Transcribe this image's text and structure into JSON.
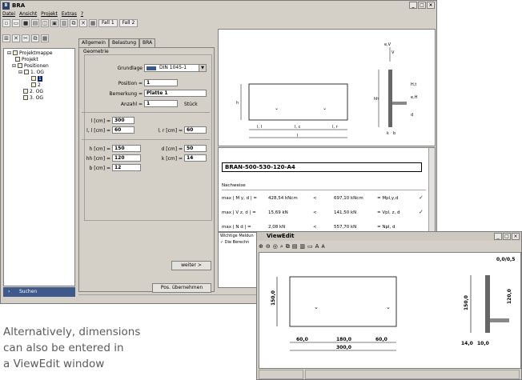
{
  "app": {
    "title": "BRA",
    "window_buttons": [
      "_",
      "□",
      "×"
    ]
  },
  "menu": [
    "Datei",
    "Ansicht",
    "Projekt",
    "Extras",
    "?"
  ],
  "toolbar": {
    "fall1": "Fall 1",
    "fall2": "Fall 2"
  },
  "tree": {
    "items": [
      "Projektmappe",
      "Projekt",
      "Positionen",
      "1. OG",
      "1",
      "2",
      "2. OG",
      "3. OG"
    ],
    "search": "Suchen"
  },
  "tabs": [
    "Allgemein",
    "Belastung",
    "BRA"
  ],
  "form": {
    "group_title": "Geometrie",
    "grundlage_label": "Grundlage",
    "grundlage_value": "DIN 1045-1",
    "position_label": "Position =",
    "position_value": "1",
    "bemerkung_label": "Bemerkung =",
    "bemerkung_value": "Platte 1",
    "anzahl_label": "Anzahl =",
    "anzahl_value": "1",
    "anzahl_unit": "Stück",
    "l_label": "l [cm] =",
    "l_value": "300",
    "ll_label": "l, l [cm] =",
    "ll_value": "60",
    "lr_label": "l, r [cm] =",
    "lr_value": "60",
    "h_label": "h [cm] =",
    "h_value": "150",
    "d_label": "d [cm] =",
    "d_value": "50",
    "hh_label": "hh [cm] =",
    "hh_value": "120",
    "k_label": "k [cm] =",
    "k_value": "14",
    "b_label": "b [cm] =",
    "b_value": "12",
    "weiter": "weiter >",
    "uebernehmen": "Pos. übernehmen"
  },
  "drawing": {
    "ll": "l, l",
    "lc": "l, c",
    "lr": "l, r",
    "l": "l",
    "h": "h",
    "ev": "e,V",
    "hh": "hh",
    "d": "d",
    "k": "k",
    "b": "b",
    "eh": "e,H",
    "ht": "H,t",
    "v": "V"
  },
  "results": {
    "code": "BRAN-500-530-120-A4",
    "heading": "Nachweise",
    "rows": [
      {
        "label": "max | M y, d | =",
        "value": "428,54 kNcm",
        "op": "<",
        "limit": "697,10 kNcm",
        "ref": "= Mpl,y,d"
      },
      {
        "label": "max | V z, d | =",
        "value": "15,69 kN",
        "op": "<",
        "limit": "141,50 kN",
        "ref": "= Vpl, z, d"
      },
      {
        "label": "max | N d | =",
        "value": "2,08 kN",
        "op": "<",
        "limit": "557,70 kN",
        "ref": "= Npl, d"
      }
    ],
    "messages_header": "Wichtige Meldun",
    "message": "Die Berechn"
  },
  "viewedit": {
    "title": "ViewEdit",
    "dims": {
      "top": "0,0/0,5",
      "h": "150,0",
      "hh": "120,0",
      "h2": "150,0",
      "ll": "60,0",
      "lc": "180,0",
      "lr": "60,0",
      "l": "300,0",
      "k": "14,0",
      "b": "10,0"
    }
  },
  "caption": [
    "Alternatively, dimensions",
    "can also be entered in",
    "a ViewEdit window"
  ]
}
